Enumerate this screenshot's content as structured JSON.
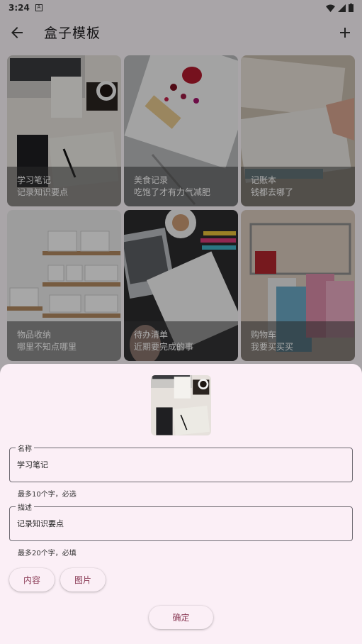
{
  "status": {
    "time": "3:24",
    "notif": "A"
  },
  "app_bar": {
    "title": "盒子模板",
    "back_icon": "arrow-back-icon",
    "add_icon": "plus-icon"
  },
  "templates": [
    {
      "title": "学习笔记",
      "desc": "记录知识要点"
    },
    {
      "title": "美食记录",
      "desc": "吃饱了才有力气减肥"
    },
    {
      "title": "记账本",
      "desc": "钱都去哪了"
    },
    {
      "title": "物品收纳",
      "desc": "哪里不知点哪里"
    },
    {
      "title": "待办清单",
      "desc": "近期要完成的事"
    },
    {
      "title": "购物车",
      "desc": "我要买买买"
    }
  ],
  "sheet": {
    "name_label": "名称",
    "name_value": "学习笔记",
    "name_helper": "最多10个字，必选",
    "desc_label": "描述",
    "desc_value": "记录知识要点",
    "desc_helper": "最多20个字，必填",
    "content_button": "内容",
    "image_button": "图片",
    "confirm_button": "确定"
  },
  "colors": {
    "sheet_bg": "#fbeff6",
    "accent": "#8a3a55",
    "outline": "#6e6a72"
  }
}
